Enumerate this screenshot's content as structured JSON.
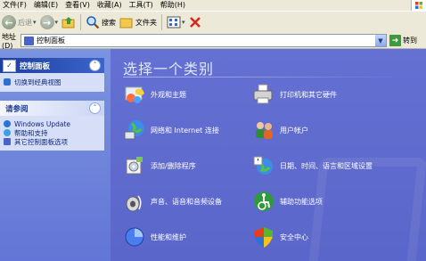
{
  "menu": [
    "文件(F)",
    "编辑(E)",
    "查看(V)",
    "收藏(A)",
    "工具(T)",
    "帮助(H)"
  ],
  "toolbar": {
    "back": "后退",
    "search": "搜索",
    "folders": "文件夹"
  },
  "address": {
    "label": "地址(D)",
    "value": "控制面板",
    "go": "转到"
  },
  "left": {
    "control_panel_title": "控制面板",
    "switch_view": "切换到经典视图",
    "see_also_title": "请参阅",
    "see_also": [
      "Windows Update",
      "帮助和支持",
      "其它控制面板选项"
    ]
  },
  "main": {
    "heading": "选择一个类别",
    "categories": [
      "外观和主题",
      "打印机和其它硬件",
      "网络和 Internet 连接",
      "用户帐户",
      "添加/删除程序",
      "日期、时间、语言和区域设置",
      "声音、语音和音频设备",
      "辅助功能选项",
      "性能和维护",
      "安全中心"
    ]
  },
  "colors": {
    "accent": "#5b69c8",
    "panel_head": "#1e3f9a"
  }
}
